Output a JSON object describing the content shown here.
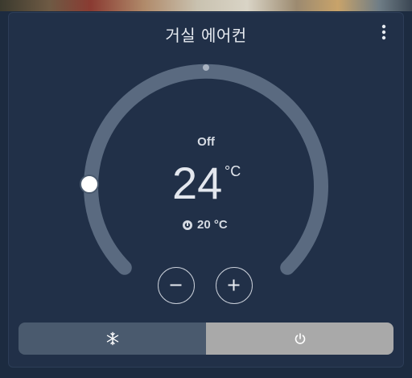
{
  "card": {
    "title": "거실 에어컨",
    "menu_icon": "more-vertical-icon"
  },
  "thermostat": {
    "mode": "Off",
    "target_temperature": "24",
    "unit": "°C",
    "current_temperature": "20 °C",
    "current_icon": "thermometer-icon"
  },
  "controls": {
    "decrease_icon": "minus-icon",
    "increase_icon": "plus-icon"
  },
  "modes": [
    {
      "icon": "snowflake-icon",
      "active": false
    },
    {
      "icon": "power-icon",
      "active": true
    }
  ],
  "colors": {
    "card_bg": "#213048",
    "arc": "#5a6a80",
    "active_mode": "#a9a9a9",
    "inactive_mode": "#4a5a6e"
  }
}
